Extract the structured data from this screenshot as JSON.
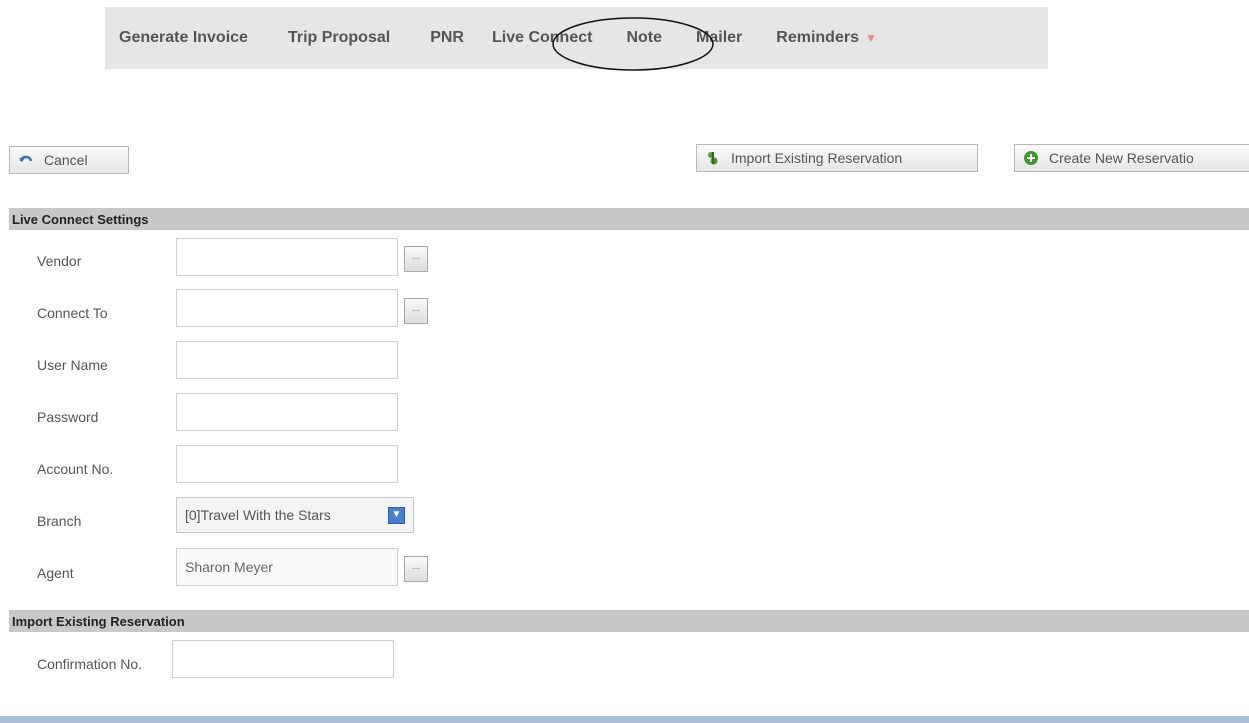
{
  "tabs": [
    {
      "label": "Generate Invoice"
    },
    {
      "label": "Trip Proposal"
    },
    {
      "label": "PNR"
    },
    {
      "label": "Live Connect"
    },
    {
      "label": "Note"
    },
    {
      "label": "Mailer"
    },
    {
      "label": "Reminders"
    }
  ],
  "actions": {
    "cancel": "Cancel",
    "import": "Import Existing Reservation",
    "create": "Create New Reservatio"
  },
  "live_connect_settings": {
    "title": "Live Connect Settings",
    "vendor_label": "Vendor",
    "vendor_value": "",
    "connect_to_label": "Connect To",
    "connect_to_value": "",
    "user_name_label": "User Name",
    "user_name_value": "",
    "password_label": "Password",
    "password_value": "",
    "account_no_label": "Account No.",
    "account_no_value": "",
    "branch_label": "Branch",
    "branch_value": "[0]Travel With the Stars",
    "agent_label": "Agent",
    "agent_value": "Sharon Meyer",
    "lookup_glyph": "..."
  },
  "import_existing": {
    "title": "Import Existing Reservation",
    "confirmation_label": "Confirmation No.",
    "confirmation_value": ""
  },
  "colors": {
    "tabbar_bg": "#e6e6e6",
    "section_bg": "#c8c8c8",
    "dropdown_blue": "#4a7fd0"
  }
}
